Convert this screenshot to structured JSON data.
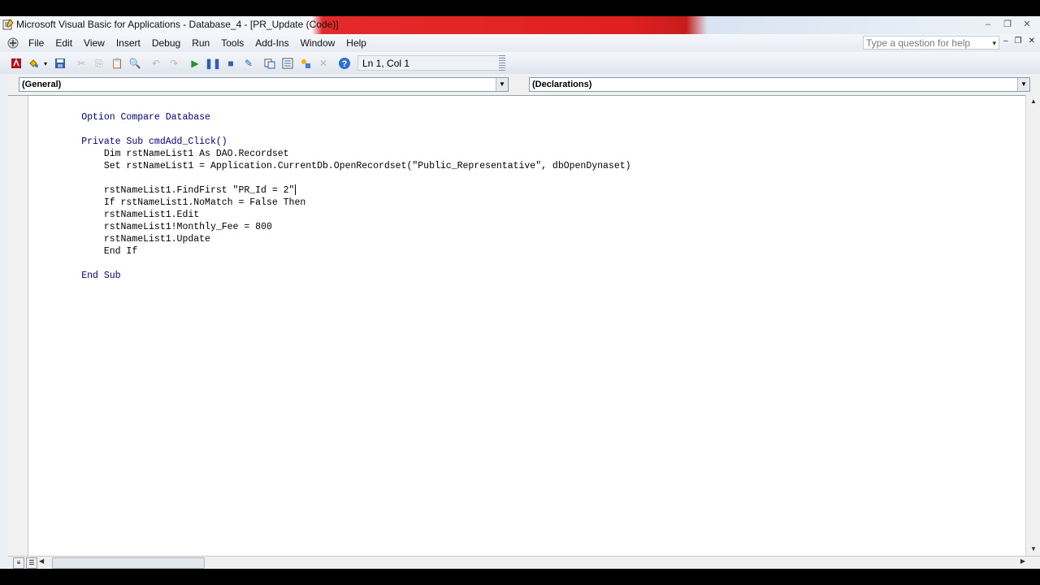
{
  "window": {
    "title": "Microsoft Visual Basic for Applications - Database_4 - [PR_Update (Code)]",
    "controls": [
      "–",
      "❐",
      "✕"
    ]
  },
  "menubar": {
    "items": [
      "File",
      "Edit",
      "View",
      "Insert",
      "Debug",
      "Run",
      "Tools",
      "Add-Ins",
      "Window",
      "Help"
    ],
    "question_placeholder": "Type a question for help",
    "mdi_controls": [
      "–",
      "❐",
      "✕"
    ]
  },
  "toolbar": {
    "position_label": "Ln 1, Col 1",
    "icons": [
      "access-icon",
      "insert-module-icon",
      "save-icon",
      "cut-icon",
      "copy-icon",
      "paste-icon",
      "find-icon",
      "undo-icon",
      "redo-icon",
      "run-icon",
      "break-icon",
      "reset-icon",
      "design-mode-icon",
      "project-explorer-icon",
      "properties-icon",
      "object-browser-icon",
      "toolbox-icon",
      "help-icon"
    ]
  },
  "code_window": {
    "object_combo": "(General)",
    "procedure_combo": "(Declarations)",
    "lines": [
      "Option Compare Database",
      "",
      "Private Sub cmdAdd_Click()",
      "    Dim rstNameList1 As DAO.Recordset",
      "    Set rstNameList1 = Application.CurrentDb.OpenRecordset(\"Public_Representative\", dbOpenDynaset)",
      "",
      "    rstNameList1.FindFirst \"PR_Id = 2\"",
      "    If rstNameList1.NoMatch = False Then",
      "    rstNameList1.Edit",
      "    rstNameList1!Monthly_Fee = 800",
      "    rstNameList1.Update",
      "    End If",
      "",
      "End Sub"
    ]
  },
  "colors": {
    "keyword": "#00007f",
    "title_bar_accent": "#e02020"
  }
}
